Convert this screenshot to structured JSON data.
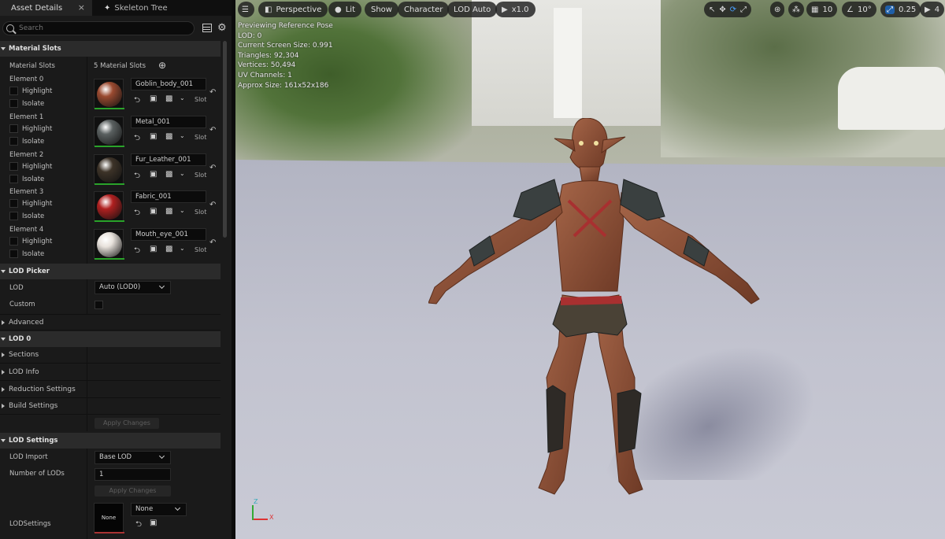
{
  "tabs": {
    "asset_details": "Asset Details",
    "skeleton_tree": "Skeleton Tree"
  },
  "search": {
    "placeholder": "Search"
  },
  "material_slots": {
    "header": "Material Slots",
    "label": "Material Slots",
    "count": "5 Material Slots",
    "highlight": "Highlight",
    "isolate": "Isolate",
    "slot": "Slot",
    "elements": [
      {
        "name": "Element 0",
        "material": "Goblin_body_001",
        "color": "#9a4a30"
      },
      {
        "name": "Element 1",
        "material": "Metal_001",
        "color": "#5a6060"
      },
      {
        "name": "Element 2",
        "material": "Fur_Leather_001",
        "color": "#3d3328"
      },
      {
        "name": "Element 3",
        "material": "Fabric_001",
        "color": "#b02020"
      },
      {
        "name": "Element 4",
        "material": "Mouth_eye_001",
        "color": "#e8e2dc"
      }
    ]
  },
  "lod_picker": {
    "header": "LOD Picker",
    "lod_label": "LOD",
    "lod_value": "Auto (LOD0)",
    "custom_label": "Custom",
    "advanced_label": "Advanced"
  },
  "lod0": {
    "header": "LOD 0",
    "sections": "Sections",
    "lod_info": "LOD Info",
    "reduction": "Reduction Settings",
    "build": "Build Settings",
    "apply": "Apply Changes"
  },
  "lod_settings": {
    "header": "LOD Settings",
    "import_label": "LOD Import",
    "import_value": "Base LOD",
    "num_label": "Number of LODs",
    "num_value": "1",
    "apply": "Apply Changes",
    "settings_label": "LODSettings",
    "thumb_label": "None",
    "dd_value": "None"
  },
  "viewport": {
    "perspective": "Perspective",
    "lit": "Lit",
    "show": "Show",
    "character": "Character",
    "lod_auto": "LOD Auto",
    "play_speed": "x1.0",
    "grid": "10",
    "angle": "10°",
    "scale": "0.25",
    "cam": "4"
  },
  "stats": {
    "line1": "Previewing Reference Pose",
    "line2": "LOD: 0",
    "line3": "Current Screen Size: 0.991",
    "line4": "Triangles: 92,304",
    "line5": "Vertices: 50,494",
    "line6": "UV Channels: 1",
    "line7": "Approx Size: 161x52x186"
  },
  "axis": {
    "z": "Z",
    "x": "X"
  }
}
